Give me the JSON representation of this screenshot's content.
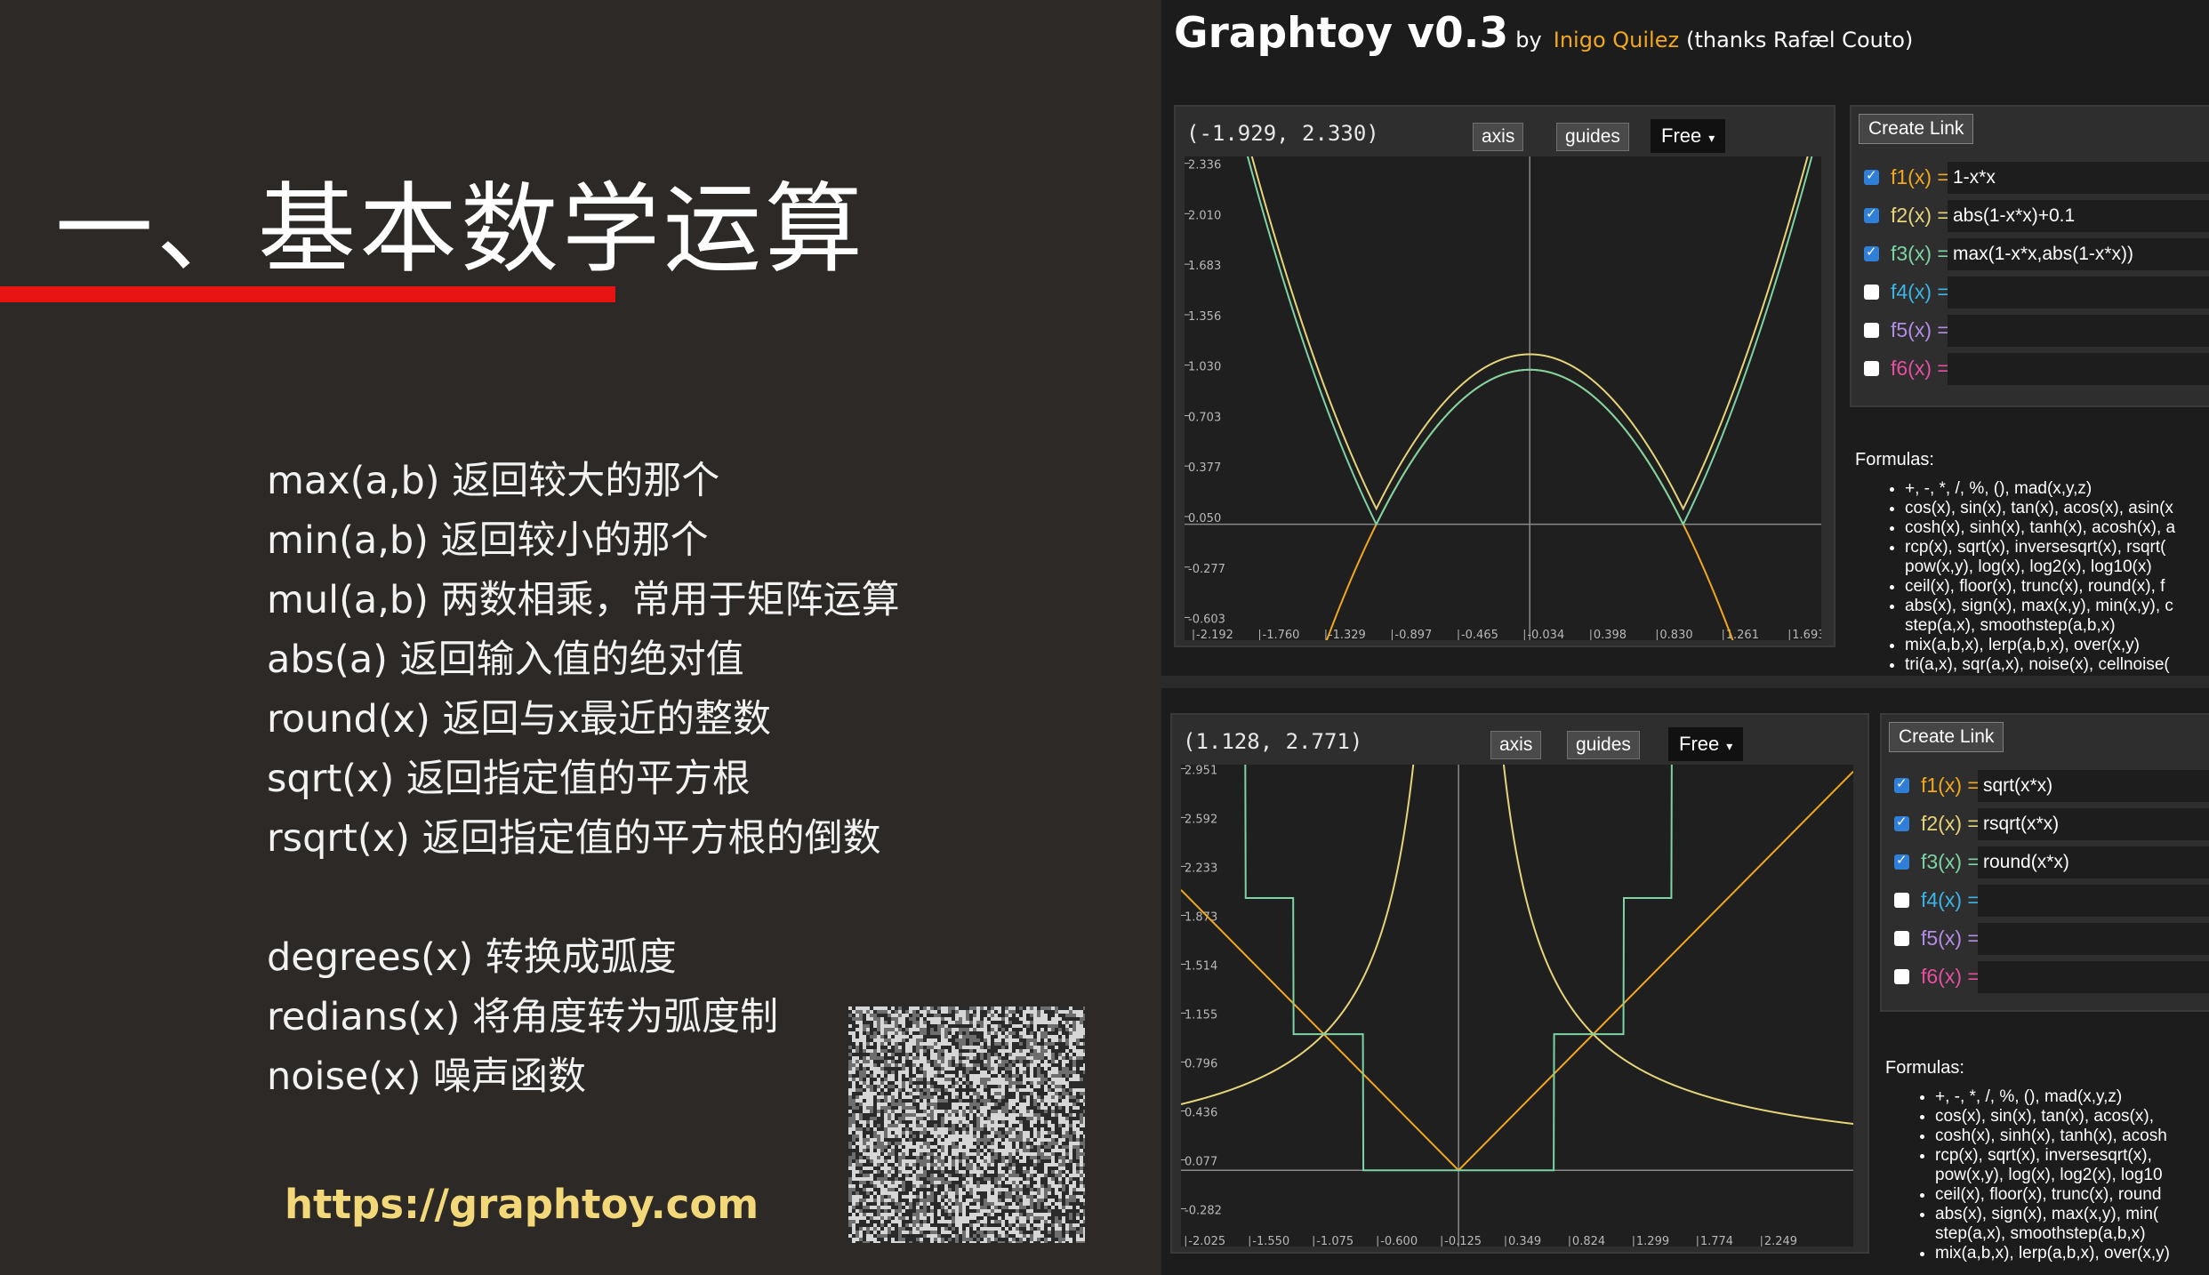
{
  "slide": {
    "title": "一、基本数学运算",
    "functions": [
      "max(a,b) 返回较大的那个",
      "min(a,b) 返回较小的那个",
      "mul(a,b) 两数相乘，常用于矩阵运算",
      "abs(a) 返回输入值的绝对值",
      "round(x) 返回与x最近的整数",
      "sqrt(x) 返回指定值的平方根",
      "rsqrt(x) 返回指定值的平方根的倒数"
    ],
    "functions2": [
      "degrees(x) 转换成弧度",
      "redians(x) 将角度转为弧度制",
      "noise(x)  噪声函数"
    ],
    "url": "https://graphtoy.com",
    "colors": {
      "accent_bar": "#e81313",
      "url": "#f2d879",
      "background": "#2c2926"
    }
  },
  "graphtoy": {
    "title": "Graphtoy v0.3",
    "by": "by",
    "author": "Inigo Quilez",
    "thanks": "(thanks Rafæl Couto)",
    "colors": {
      "f1": "#f2a81d",
      "f2": "#e6d47a",
      "f3": "#7dd3a3",
      "f4": "#3cb4e6",
      "f5": "#b48ce6",
      "f6": "#e64fa0"
    },
    "panels": [
      {
        "coords": "(-1.929, 2.330)",
        "axis_label": "axis",
        "guides_label": "guides",
        "mode": "Free",
        "create_link": "Create Link",
        "functions": [
          {
            "label": "f1(x) =",
            "expr": "1-x*x",
            "checked": true,
            "color_key": "f1"
          },
          {
            "label": "f2(x) =",
            "expr": "abs(1-x*x)+0.1",
            "checked": true,
            "color_key": "f2"
          },
          {
            "label": "f3(x) =",
            "expr": "max(1-x*x,abs(1-x*x))",
            "checked": true,
            "color_key": "f3"
          },
          {
            "label": "f4(x) =",
            "expr": "",
            "checked": false,
            "color_key": "f4"
          },
          {
            "label": "f5(x) =",
            "expr": "",
            "checked": false,
            "color_key": "f5"
          },
          {
            "label": "f6(x) =",
            "expr": "",
            "checked": false,
            "color_key": "f6"
          }
        ],
        "formulas_heading": "Formulas:",
        "formulas": [
          "+, -, *, /, %, (), mad(x,y,z)",
          "cos(x), sin(x), tan(x), acos(x), asin(x",
          "cosh(x), sinh(x), tanh(x), acosh(x), a",
          "rcp(x), sqrt(x), inversesqrt(x), rsqrt(",
          "pow(x,y), log(x), log2(x), log10(x)",
          "ceil(x), floor(x), trunc(x), round(x), f",
          "abs(x), sign(x), max(x,y), min(x,y), c",
          "step(a,x), smoothstep(a,b,x)",
          "mix(a,b,x), lerp(a,b,x), over(x,y)",
          "tri(a,x), sqr(a,x), noise(x), cellnoise("
        ],
        "formula_continuation": [
          false,
          false,
          false,
          false,
          true,
          false,
          false,
          true,
          false,
          false
        ],
        "chart_data": {
          "type": "line",
          "xlim": [
            -2.25,
            1.9
          ],
          "ylim": [
            -0.75,
            2.38
          ],
          "x_ticks": [
            "-2.192",
            "-1.760",
            "-1.329",
            "-0.897",
            "-0.465",
            "-0.034",
            "0.398",
            "0.830",
            "1.261",
            "1.693"
          ],
          "x_tick_values": [
            -2.192,
            -1.76,
            -1.329,
            -0.897,
            -0.465,
            -0.034,
            0.398,
            0.83,
            1.261,
            1.693
          ],
          "y_ticks": [
            "2.336",
            "2.010",
            "1.683",
            "1.356",
            "1.030",
            "0.703",
            "0.377",
            "0.050",
            "-0.277",
            "-0.603"
          ],
          "y_tick_values": [
            2.336,
            2.01,
            1.683,
            1.356,
            1.03,
            0.703,
            0.377,
            0.05,
            -0.277,
            -0.603
          ],
          "grid": false,
          "series": [
            {
              "expr": "1-x*x",
              "color_key": "f1"
            },
            {
              "expr": "abs(1-x*x)+0.1",
              "color_key": "f2"
            },
            {
              "expr": "max(1-x*x,abs(1-x*x))",
              "color_key": "f3"
            }
          ]
        }
      },
      {
        "coords": "(1.128, 2.771)",
        "axis_label": "axis",
        "guides_label": "guides",
        "mode": "Free",
        "create_link": "Create Link",
        "functions": [
          {
            "label": "f1(x) =",
            "expr": "sqrt(x*x)",
            "checked": true,
            "color_key": "f1"
          },
          {
            "label": "f2(x) =",
            "expr": "rsqrt(x*x)",
            "checked": true,
            "color_key": "f2"
          },
          {
            "label": "f3(x) =",
            "expr": "round(x*x)",
            "checked": true,
            "color_key": "f3"
          },
          {
            "label": "f4(x) =",
            "expr": "",
            "checked": false,
            "color_key": "f4"
          },
          {
            "label": "f5(x) =",
            "expr": "",
            "checked": false,
            "color_key": "f5"
          },
          {
            "label": "f6(x) =",
            "expr": "",
            "checked": false,
            "color_key": "f6"
          }
        ],
        "formulas_heading": "Formulas:",
        "formulas": [
          "+, -, *, /, %, (), mad(x,y,z)",
          "cos(x), sin(x), tan(x), acos(x),",
          "cosh(x), sinh(x), tanh(x), acosh",
          "rcp(x), sqrt(x), inversesqrt(x),",
          "pow(x,y), log(x), log2(x), log10",
          "ceil(x), floor(x), trunc(x), round",
          "abs(x), sign(x), max(x,y), min(",
          "step(a,x), smoothstep(a,b,x)",
          "mix(a,b,x), lerp(a,b,x), over(x,y)"
        ],
        "formula_continuation": [
          false,
          false,
          false,
          false,
          true,
          false,
          false,
          true,
          false
        ],
        "chart_data": {
          "type": "line",
          "xlim": [
            -2.06,
            2.93
          ],
          "ylim": [
            -0.56,
            2.98
          ],
          "x_ticks": [
            "-2.025",
            "-1.550",
            "-1.075",
            "-0.600",
            "-0.125",
            "0.349",
            "0.824",
            "1.299",
            "1.774",
            "2.249"
          ],
          "x_tick_values": [
            -2.025,
            -1.55,
            -1.075,
            -0.6,
            -0.125,
            0.349,
            0.824,
            1.299,
            1.774,
            2.249
          ],
          "y_ticks": [
            "2.951",
            "2.592",
            "2.233",
            "1.873",
            "1.514",
            "1.155",
            "0.796",
            "0.436",
            "0.077",
            "-0.282"
          ],
          "y_tick_values": [
            2.951,
            2.592,
            2.233,
            1.873,
            1.514,
            1.155,
            0.796,
            0.436,
            0.077,
            -0.282
          ],
          "grid": false,
          "series": [
            {
              "expr": "sqrt(x*x)",
              "color_key": "f1"
            },
            {
              "expr": "rsqrt(x*x)",
              "color_key": "f2"
            },
            {
              "expr": "round(x*x)",
              "color_key": "f3"
            }
          ]
        }
      }
    ]
  }
}
